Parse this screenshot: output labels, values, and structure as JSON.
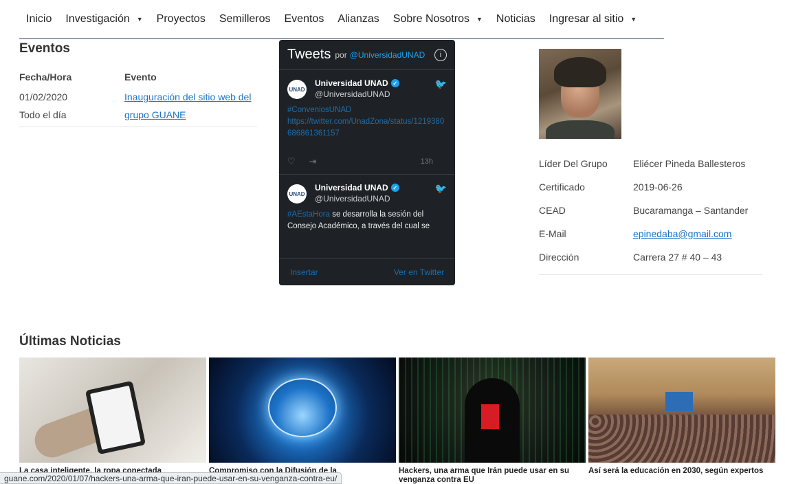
{
  "nav": {
    "items": [
      {
        "label": "Inicio",
        "dropdown": false
      },
      {
        "label": "Investigación",
        "dropdown": true
      },
      {
        "label": "Proyectos",
        "dropdown": false
      },
      {
        "label": "Semilleros",
        "dropdown": false
      },
      {
        "label": "Eventos",
        "dropdown": false
      },
      {
        "label": "Alianzas",
        "dropdown": false
      },
      {
        "label": "Sobre Nosotros",
        "dropdown": true
      },
      {
        "label": "Noticias",
        "dropdown": false
      },
      {
        "label": "Ingresar al sitio",
        "dropdown": true
      }
    ]
  },
  "events": {
    "title": "Eventos",
    "col_date": "Fecha/Hora",
    "col_event": "Evento",
    "rows": [
      {
        "date": "01/02/2020",
        "event": "Inauguración del sitio web del"
      },
      {
        "date": "Todo el día",
        "event": "grupo GUANE"
      }
    ]
  },
  "twitter": {
    "title": "Tweets",
    "by": "por",
    "account": "@UniversidadUNAD",
    "tweets": [
      {
        "name": "Universidad UNAD",
        "handle": "@UniversidadUNAD",
        "hashtag": "#ConveniosUNAD",
        "text": "https://twitter.com/UnadZona/status/1219380686861361157",
        "time": "13h"
      },
      {
        "name": "Universidad UNAD",
        "handle": "@UniversidadUNAD",
        "hashtag": "#AEstaHora",
        "text": " se desarrolla la sesión del Consejo Académico, a través del cual se"
      }
    ],
    "insert_label": "Insertar",
    "view_label": "Ver en Twitter"
  },
  "leader": {
    "rows": [
      {
        "label": "Líder Del Grupo",
        "value": "Eliécer Pineda Ballesteros"
      },
      {
        "label": "Certificado",
        "value": "2019-06-26"
      },
      {
        "label": "CEAD",
        "value": "Bucaramanga –  Santander"
      },
      {
        "label": "E-Mail",
        "value": "epinedaba@gmail.com"
      },
      {
        "label": "Dirección",
        "value": "Carrera 27 # 40 – 43"
      }
    ]
  },
  "news": {
    "title": "Últimas Noticias",
    "items": [
      {
        "caption": "La casa inteligente, la ropa conectada"
      },
      {
        "caption": "Compromiso con la Difusión de la"
      },
      {
        "caption": "Hackers, una arma que Irán puede usar en su venganza contra EU"
      },
      {
        "caption": "Así será la educación en 2030, según expertos"
      }
    ]
  },
  "status_url": "guane.com/2020/01/07/hackers-una-arma-que-iran-puede-usar-en-su-venganza-contra-eu/"
}
